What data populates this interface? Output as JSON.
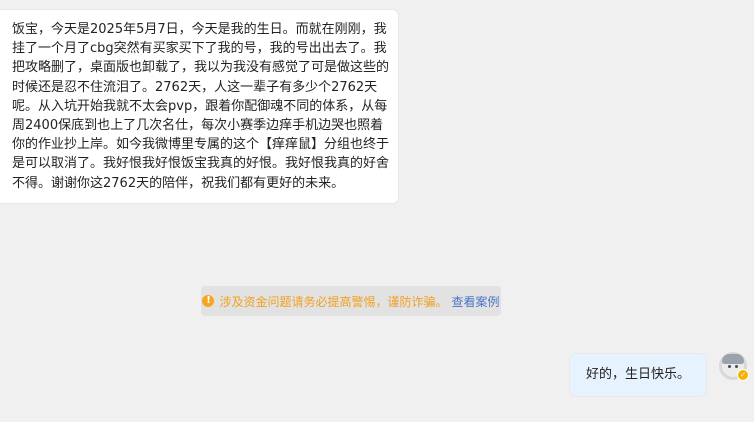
{
  "messages": [
    {
      "direction": "incoming",
      "text": "饭宝，今天是2025年5月7日，今天是我的生日。而就在刚刚，我挂了一个月了cbg突然有买家买下了我的号，我的号出出去了。我把攻略删了，桌面版也卸载了，我以为我没有感觉了可是做这些的时候还是忍不住流泪了。2762天，人这一辈子有多少个2762天呢。从入坑开始我就不太会pvp，跟着你配御魂不同的体系，从每周2400保底到也上了几次名仕，每次小赛季边痒手机边哭也照着你的作业抄上岸。如今我微博里专属的这个【痒痒鼠】分组也终于是可以取消了。我好恨我好恨饭宝我真的好恨。我好恨我真的好舍不得。谢谢你这2762天的陪伴，祝我们都有更好的未来。"
    },
    {
      "direction": "outgoing",
      "text": "好的，生日快乐。"
    }
  ],
  "notice": {
    "icon": "warning-icon",
    "text": "涉及资金问题请务必提高警惕，谨防诈骗。",
    "link": "查看案例"
  },
  "colors": {
    "background": "#f0f0f0",
    "incoming_bubble": "#ffffff",
    "outgoing_bubble": "#e6f2fd",
    "notice_text": "#f0a020",
    "notice_link": "#4a74c9"
  }
}
